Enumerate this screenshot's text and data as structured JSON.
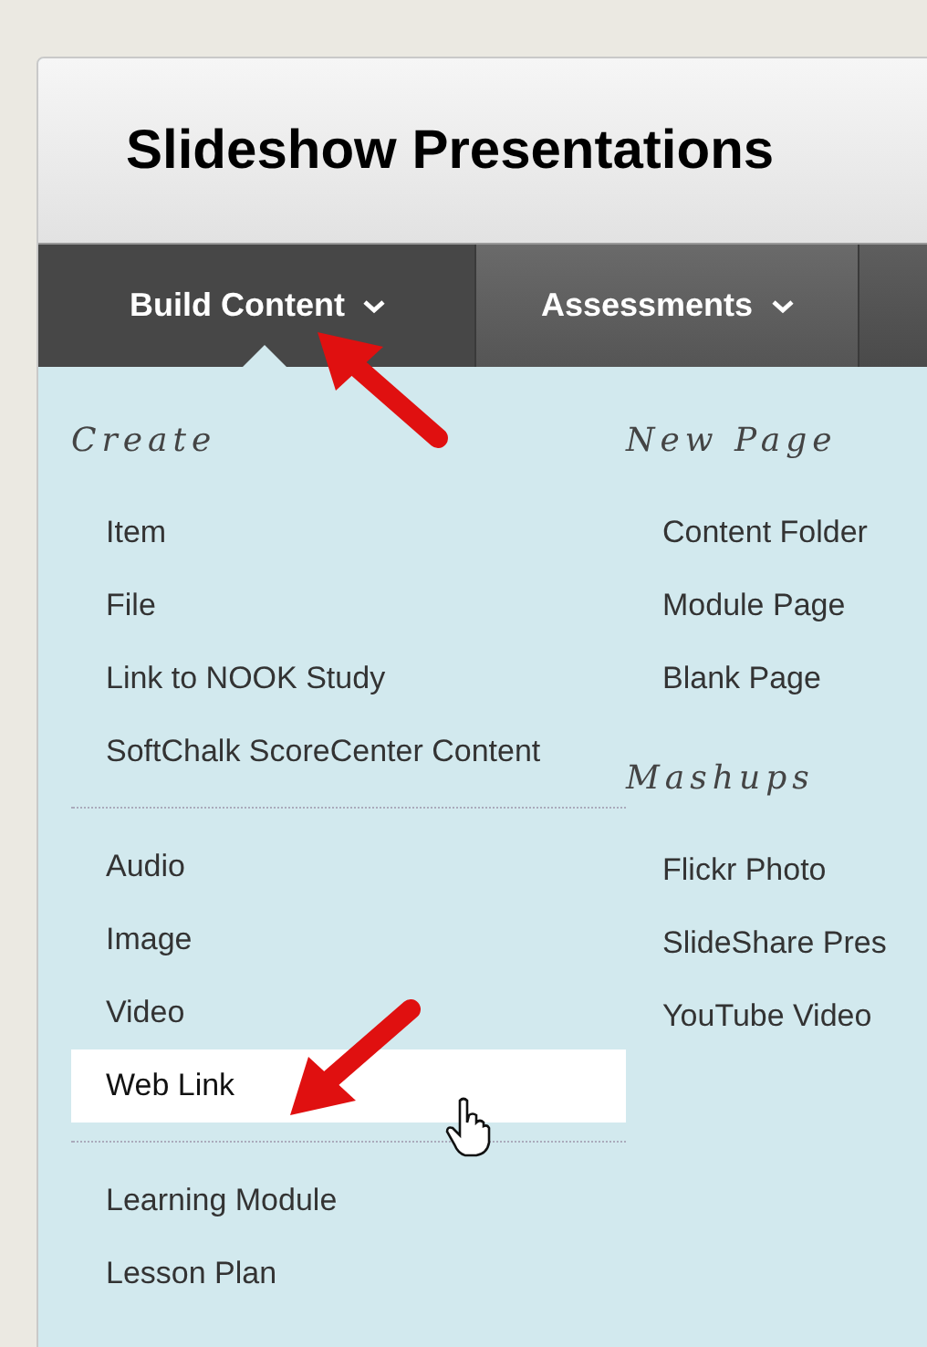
{
  "page_title": "Slideshow Presentations",
  "tabs": [
    {
      "label": "Build Content",
      "selected": true
    },
    {
      "label": "Assessments",
      "selected": false
    }
  ],
  "menu_columns": [
    {
      "sections": [
        {
          "heading": "Create",
          "items": [
            {
              "label": "Item",
              "selected": false
            },
            {
              "label": "File",
              "selected": false
            },
            {
              "label": "Link to NOOK Study",
              "selected": false
            },
            {
              "label": "SoftChalk ScoreCenter Content",
              "selected": false
            }
          ]
        },
        {
          "items": [
            {
              "label": "Audio",
              "selected": false
            },
            {
              "label": "Image",
              "selected": false
            },
            {
              "label": "Video",
              "selected": false
            },
            {
              "label": "Web Link",
              "selected": true
            }
          ]
        },
        {
          "items": [
            {
              "label": "Learning Module",
              "selected": false
            },
            {
              "label": "Lesson Plan",
              "selected": false
            }
          ]
        }
      ]
    },
    {
      "sections": [
        {
          "heading": "New Page",
          "items": [
            {
              "label": "Content Folder",
              "selected": false
            },
            {
              "label": "Module Page",
              "selected": false
            },
            {
              "label": "Blank Page",
              "selected": false
            }
          ]
        },
        {
          "heading": "Mashups",
          "items": [
            {
              "label": "Flickr Photo",
              "selected": false
            },
            {
              "label": "SlideShare Pres",
              "selected": false
            },
            {
              "label": "YouTube Video",
              "selected": false
            }
          ]
        }
      ]
    }
  ]
}
